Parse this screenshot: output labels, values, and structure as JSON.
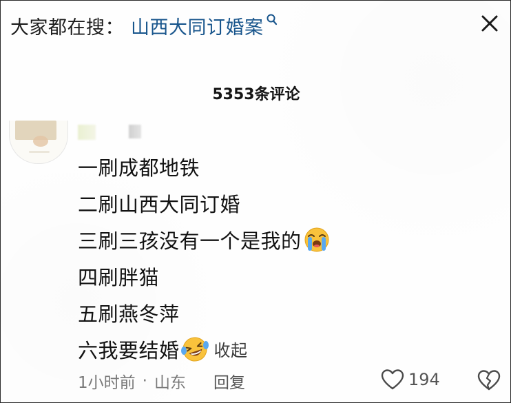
{
  "search": {
    "prefix": "大家都在搜：",
    "term": "山西大同订婚案"
  },
  "comments": {
    "title": "5353条评论"
  },
  "comment": {
    "lines": [
      "一刷成都地铁",
      "二刷山西大同订婚",
      "三刷三孩没有一个是我的",
      "四刷胖猫",
      "五刷燕冬萍",
      "六我要结婚"
    ],
    "collapse_label": "收起",
    "time": "1小时前",
    "dot": "·",
    "location": "山东",
    "reply_label": "回复",
    "like_count": "194"
  },
  "icons": {
    "search": "search-icon",
    "close": "close-icon",
    "crying_emoji": "loudly-crying-face-icon",
    "laughing_emoji": "laughing-crying-face-icon",
    "like": "heart-outline-icon",
    "dislike": "broken-heart-icon"
  },
  "colors": {
    "search_term": "#18558c",
    "text": "#121212",
    "meta": "#7a7a7a"
  }
}
